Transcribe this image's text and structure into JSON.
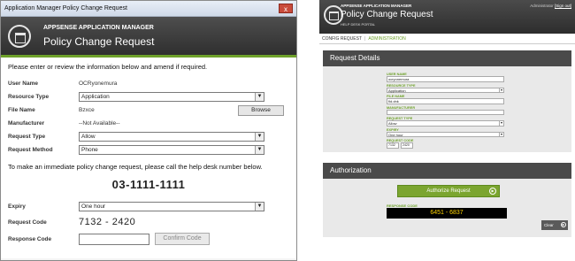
{
  "window": {
    "title": "Application Manager Policy Change Request",
    "close": "x"
  },
  "left": {
    "brand": "APPSENSE APPLICATION MANAGER",
    "title": "Policy Change Request",
    "intro": "Please enter or review the information below and amend if required.",
    "fields": {
      "user_name_label": "User Name",
      "user_name_value": "OCRyonemura",
      "resource_type_label": "Resource Type",
      "resource_type_value": "Application",
      "file_name_label": "File Name",
      "file_name_value": "Bzxce",
      "browse_label": "Browse",
      "manufacturer_label": "Manufacturer",
      "manufacturer_value": "--Not Available--",
      "request_type_label": "Request Type",
      "request_type_value": "Allow",
      "request_method_label": "Request Method",
      "request_method_value": "Phone"
    },
    "note": "To make an immediate policy change request, please call the help desk number below.",
    "phone": "03-1111-1111",
    "expiry_label": "Expiry",
    "expiry_value": "One hour",
    "request_code_label": "Request Code",
    "request_code_value": "7132 - 2420",
    "response_code_label": "Response Code",
    "response_code_value": "",
    "confirm_label": "Confirm Code"
  },
  "right": {
    "brand": "APPSENSE APPLICATION MANAGER",
    "title": "Policy Change Request",
    "subtitle": "HELP DESK PORTAL",
    "admin": "Administrator",
    "logout": "[Sign out]",
    "tabs": [
      "CONFIG REQUEST",
      "ADMINISTRATION"
    ],
    "details_title": "Request Details",
    "fields": [
      {
        "label": "USER NAME",
        "value": "ocryonemura"
      },
      {
        "label": "RESOURCE TYPE",
        "value": "Application"
      },
      {
        "label": "FILE NAME",
        "value": "fid.dnk"
      },
      {
        "label": "MANUFACTURER",
        "value": ""
      },
      {
        "label": "REQUEST TYPE",
        "value": "Allow"
      },
      {
        "label": "EXPIRY",
        "value": "One hour"
      }
    ],
    "request_code_label": "REQUEST CODE",
    "request_code_parts": [
      "7132",
      "2420"
    ],
    "auth_title": "Authorization",
    "authorize_label": "Authorize Request",
    "response_label": "RESPONSE CODE",
    "response_value": "6451 - 6837",
    "close_label": "Clear"
  },
  "colors": {
    "accent": "#6ea12a",
    "header": "#3a3a3a",
    "response_text": "#ffd400"
  }
}
